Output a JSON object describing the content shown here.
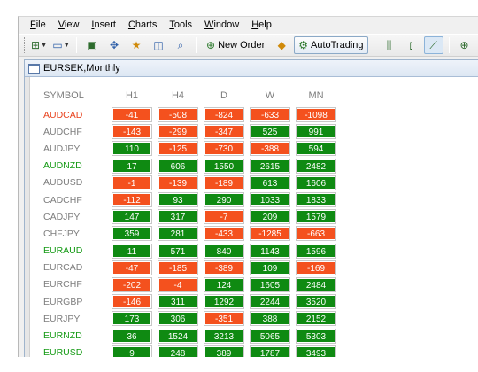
{
  "menu": {
    "items": [
      {
        "label": "File",
        "name": "menu-file"
      },
      {
        "label": "View",
        "name": "menu-view"
      },
      {
        "label": "Insert",
        "name": "menu-insert"
      },
      {
        "label": "Charts",
        "name": "menu-charts"
      },
      {
        "label": "Tools",
        "name": "menu-tools"
      },
      {
        "label": "Window",
        "name": "menu-window"
      },
      {
        "label": "Help",
        "name": "menu-help"
      }
    ]
  },
  "toolbar": {
    "new_order_label": "New Order",
    "autotrading_label": "AutoTrading",
    "icons": [
      "new-chart-icon",
      "profiles-icon",
      "market-watch-icon",
      "navigator-icon",
      "data-window-icon",
      "terminal-icon",
      "strategy-tester-icon",
      "bar-chart-icon",
      "candlestick-icon",
      "line-chart-icon",
      "zoom-in-icon",
      "zoom-out-icon",
      "tile-windows-icon"
    ]
  },
  "window": {
    "title": "EURSEK,Monthly"
  },
  "grid": {
    "headers": [
      "SYMBOL",
      "H1",
      "H4",
      "D",
      "W",
      "MN"
    ],
    "colors": {
      "positive": "#0f8a12",
      "negative": "#f4511e",
      "symbol_red": "#e8431e",
      "symbol_green": "#149a14",
      "symbol_gray": "#7d7d7d"
    },
    "rows": [
      {
        "symbol": "AUDCAD",
        "symbol_color": "red",
        "values": [
          "-41",
          "-508",
          "-824",
          "-633",
          "-1098"
        ]
      },
      {
        "symbol": "AUDCHF",
        "symbol_color": "gray",
        "values": [
          "-143",
          "-299",
          "-347",
          "525",
          "991"
        ]
      },
      {
        "symbol": "AUDJPY",
        "symbol_color": "gray",
        "values": [
          "110",
          "-125",
          "-730",
          "-388",
          "594"
        ]
      },
      {
        "symbol": "AUDNZD",
        "symbol_color": "green",
        "values": [
          "17",
          "606",
          "1550",
          "2615",
          "2482"
        ]
      },
      {
        "symbol": "AUDUSD",
        "symbol_color": "gray",
        "values": [
          "-1",
          "-139",
          "-189",
          "613",
          "1606"
        ]
      },
      {
        "symbol": "CADCHF",
        "symbol_color": "gray",
        "values": [
          "-112",
          "93",
          "290",
          "1033",
          "1833"
        ]
      },
      {
        "symbol": "CADJPY",
        "symbol_color": "gray",
        "values": [
          "147",
          "317",
          "-7",
          "209",
          "1579"
        ]
      },
      {
        "symbol": "CHFJPY",
        "symbol_color": "gray",
        "values": [
          "359",
          "281",
          "-433",
          "-1285",
          "-663"
        ]
      },
      {
        "symbol": "EURAUD",
        "symbol_color": "green",
        "values": [
          "11",
          "571",
          "840",
          "1143",
          "1596"
        ]
      },
      {
        "symbol": "EURCAD",
        "symbol_color": "gray",
        "values": [
          "-47",
          "-185",
          "-389",
          "109",
          "-169"
        ]
      },
      {
        "symbol": "EURCHF",
        "symbol_color": "gray",
        "values": [
          "-202",
          "-4",
          "124",
          "1605",
          "2484"
        ]
      },
      {
        "symbol": "EURGBP",
        "symbol_color": "gray",
        "values": [
          "-146",
          "311",
          "1292",
          "2244",
          "3520"
        ]
      },
      {
        "symbol": "EURJPY",
        "symbol_color": "gray",
        "values": [
          "173",
          "306",
          "-351",
          "388",
          "2152"
        ]
      },
      {
        "symbol": "EURNZD",
        "symbol_color": "green",
        "values": [
          "36",
          "1524",
          "3213",
          "5065",
          "5303"
        ]
      },
      {
        "symbol": "EURUSD",
        "symbol_color": "green",
        "values": [
          "9",
          "248",
          "389",
          "1787",
          "3493"
        ]
      }
    ]
  }
}
